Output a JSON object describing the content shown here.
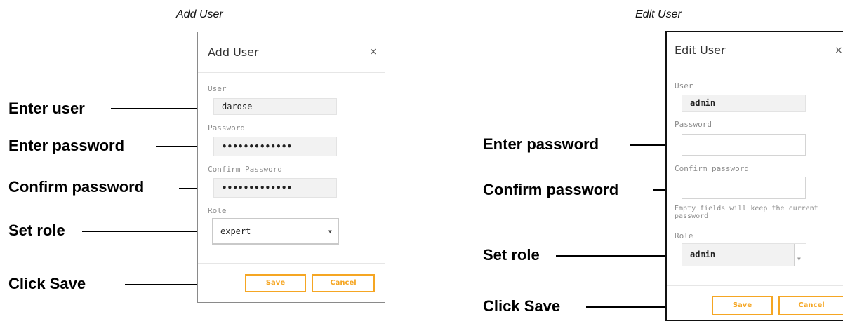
{
  "captions": {
    "add": "Add User",
    "edit": "Edit User"
  },
  "add_dialog": {
    "title": "Add User",
    "close": "×",
    "user_label": "User",
    "user_value": "darose",
    "password_label": "Password",
    "password_value": "•••••••••••••",
    "confirm_label": "Confirm Password",
    "confirm_value": "•••••••••••••",
    "role_label": "Role",
    "role_value": "expert",
    "save_label": "Save",
    "cancel_label": "Cancel"
  },
  "edit_dialog": {
    "title": "Edit User",
    "close": "×",
    "user_label": "User",
    "user_value": "admin",
    "password_label": "Password",
    "password_value": "",
    "confirm_label": "Confirm password",
    "confirm_value": "",
    "hint": "Empty fields will keep the current password",
    "role_label": "Role",
    "role_value": "admin",
    "save_label": "Save",
    "cancel_label": "Cancel"
  },
  "callouts_left": {
    "enter_user": "Enter user",
    "enter_password": "Enter password",
    "confirm_password": "Confirm password",
    "set_role": "Set role",
    "click_save": "Click Save"
  },
  "callouts_right": {
    "enter_password": "Enter password",
    "confirm_password": "Confirm password",
    "set_role": "Set role",
    "click_save": "Click Save"
  },
  "icons": {
    "close": "close-icon",
    "dropdown": "chevron-down-icon"
  },
  "colors": {
    "accent": "#f5a623",
    "label": "#8c8c8c",
    "field_bg": "#f2f2f2"
  }
}
